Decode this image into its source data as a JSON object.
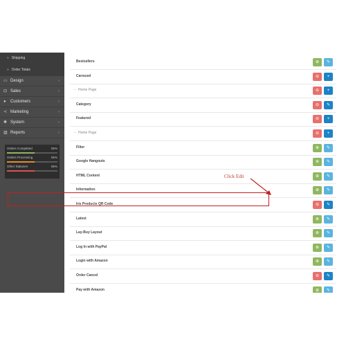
{
  "sidebar": {
    "sub_items": [
      {
        "label": "Shipping"
      },
      {
        "label": "Order Totals"
      }
    ],
    "menu": [
      {
        "label": "Design",
        "icon": "desktop-icon"
      },
      {
        "label": "Sales",
        "icon": "cart-icon"
      },
      {
        "label": "Customers",
        "icon": "user-icon"
      },
      {
        "label": "Marketing",
        "icon": "share-icon"
      },
      {
        "label": "System",
        "icon": "gear-icon"
      },
      {
        "label": "Reports",
        "icon": "bar-chart-icon"
      }
    ],
    "stats": [
      {
        "label": "Orders Completed",
        "value": "55%",
        "fraction": 0.55,
        "color": "#8fb760"
      },
      {
        "label": "Orders Processing",
        "value": "55%",
        "fraction": 0.55,
        "color": "#e38b2c"
      },
      {
        "label": "Other Statuses",
        "value": "55%",
        "fraction": 0.55,
        "color": "#d9534f"
      }
    ]
  },
  "modules": [
    {
      "label": "Bestsellers",
      "status": "uninstalled"
    },
    {
      "label": "Carousel",
      "status": "installed"
    },
    {
      "label": "Home Page",
      "status": "installed",
      "sub": true
    },
    {
      "label": "Category",
      "status": "installed"
    },
    {
      "label": "Featured",
      "status": "installed"
    },
    {
      "label": "Home Page",
      "status": "installed",
      "sub": true
    },
    {
      "label": "Filter",
      "status": "uninstalled"
    },
    {
      "label": "Google Hangouts",
      "status": "uninstalled"
    },
    {
      "label": "HTML Content",
      "status": "uninstalled"
    },
    {
      "label": "Information",
      "status": "uninstalled"
    },
    {
      "label": "Iris Products QR Code",
      "status": "installed",
      "highlighted": true
    },
    {
      "label": "Latest",
      "status": "uninstalled"
    },
    {
      "label": "Lay-Buy Layout",
      "status": "uninstalled"
    },
    {
      "label": "Log In with PayPal",
      "status": "uninstalled"
    },
    {
      "label": "Login with Amazon",
      "status": "uninstalled"
    },
    {
      "label": "Order Cancel",
      "status": "installed"
    },
    {
      "label": "Pay with Amazon",
      "status": "uninstalled"
    }
  ],
  "annotation": {
    "text": "Click Edit",
    "color": "#c41e1e"
  },
  "colors": {
    "install_green": "#8fb760",
    "uninstall_red": "#e8706c",
    "edit_light_blue": "#5bb4df",
    "edit_dark_blue": "#1d83c4"
  }
}
